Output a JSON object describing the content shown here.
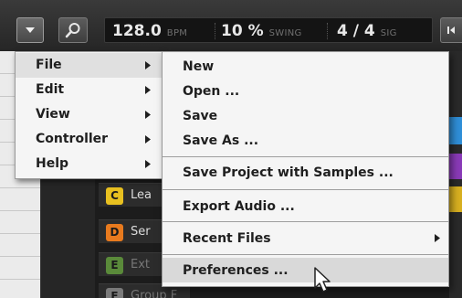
{
  "toolbar": {
    "tempo_value": "128.0",
    "tempo_unit": "BPM",
    "swing_value": "10 %",
    "swing_unit": "SWING",
    "signature_value": "4 / 4",
    "signature_unit": "SIG"
  },
  "main_menu": {
    "items": [
      {
        "label": "File",
        "has_submenu": true,
        "active": true
      },
      {
        "label": "Edit",
        "has_submenu": true
      },
      {
        "label": "View",
        "has_submenu": true
      },
      {
        "label": "Controller",
        "has_submenu": true
      },
      {
        "label": "Help",
        "has_submenu": true
      }
    ]
  },
  "file_menu": {
    "items": [
      {
        "label": "New"
      },
      {
        "label": "Open ..."
      },
      {
        "label": "Save"
      },
      {
        "label": "Save As ..."
      },
      {
        "label": "Save Project with Samples ..."
      },
      {
        "label": "Export Audio ..."
      },
      {
        "label": "Recent Files",
        "has_submenu": true
      },
      {
        "label": "Preferences ...",
        "hovered": true
      }
    ]
  },
  "groups": [
    {
      "letter": "C",
      "name": "Lea",
      "color": "#e8c020"
    },
    {
      "letter": "D",
      "name": "Ser",
      "color": "#e87a1e"
    },
    {
      "letter": "E",
      "name": "Ext",
      "color": "#5a8a3a"
    },
    {
      "letter": "F",
      "name": "Group F",
      "color": "#7a7a7a"
    }
  ],
  "colors": {
    "menu_bg": "#f5f5f5",
    "hover_bg": "#d9d9d9",
    "strip_blue": "#2f8fd8",
    "strip_purple": "#8a3ab8",
    "strip_yellow": "#d8b020"
  }
}
